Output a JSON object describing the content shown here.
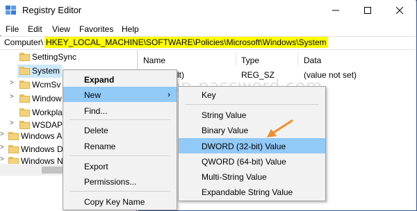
{
  "window": {
    "title": "Registry Editor",
    "accent_color": "#2b579a",
    "controls": [
      "minimize-icon",
      "maximize-icon",
      "close-icon"
    ]
  },
  "menubar": {
    "items": [
      "File",
      "Edit",
      "View",
      "Favorites",
      "Help"
    ]
  },
  "address": {
    "prefix": "Computer\\",
    "path": "HKEY_LOCAL_MACHINE\\SOFTWARE\\Policies\\Microsoft\\Windows\\System",
    "highlight_color": "#ffff00"
  },
  "tree": {
    "items": [
      {
        "label": "SettingSync"
      },
      {
        "label": "System",
        "selected": true
      },
      {
        "label": "WcmSv"
      },
      {
        "label": "Window"
      },
      {
        "label": "Workpla"
      },
      {
        "label": "WSDAP"
      },
      {
        "label": "Windows A"
      },
      {
        "label": "Windows D"
      },
      {
        "label": "Windows N"
      }
    ]
  },
  "list": {
    "columns": [
      "Name",
      "Type",
      "Data"
    ],
    "rows": [
      {
        "name": "lt)",
        "type": "REG_SZ",
        "data": "(value not set)"
      }
    ]
  },
  "context_menu": {
    "items": [
      "Expand",
      "New",
      "Find...",
      "Delete",
      "Rename",
      "Export",
      "Permissions...",
      "Copy Key Name"
    ],
    "hovered": "New",
    "submenu_arrow": "chevron-right-icon"
  },
  "submenu": {
    "items": [
      "Key",
      "String Value",
      "Binary Value",
      "DWORD (32-bit) Value",
      "QWORD (64-bit) Value",
      "Multi-String Value",
      "Expandable String Value"
    ],
    "hovered": "DWORD (32-bit) Value",
    "hover_color": "#91c9f7"
  },
  "annotation": {
    "arrow": "orange-arrow-icon",
    "arrow_color": "#f28c28"
  },
  "watermark": {
    "text": "top-password.com"
  }
}
